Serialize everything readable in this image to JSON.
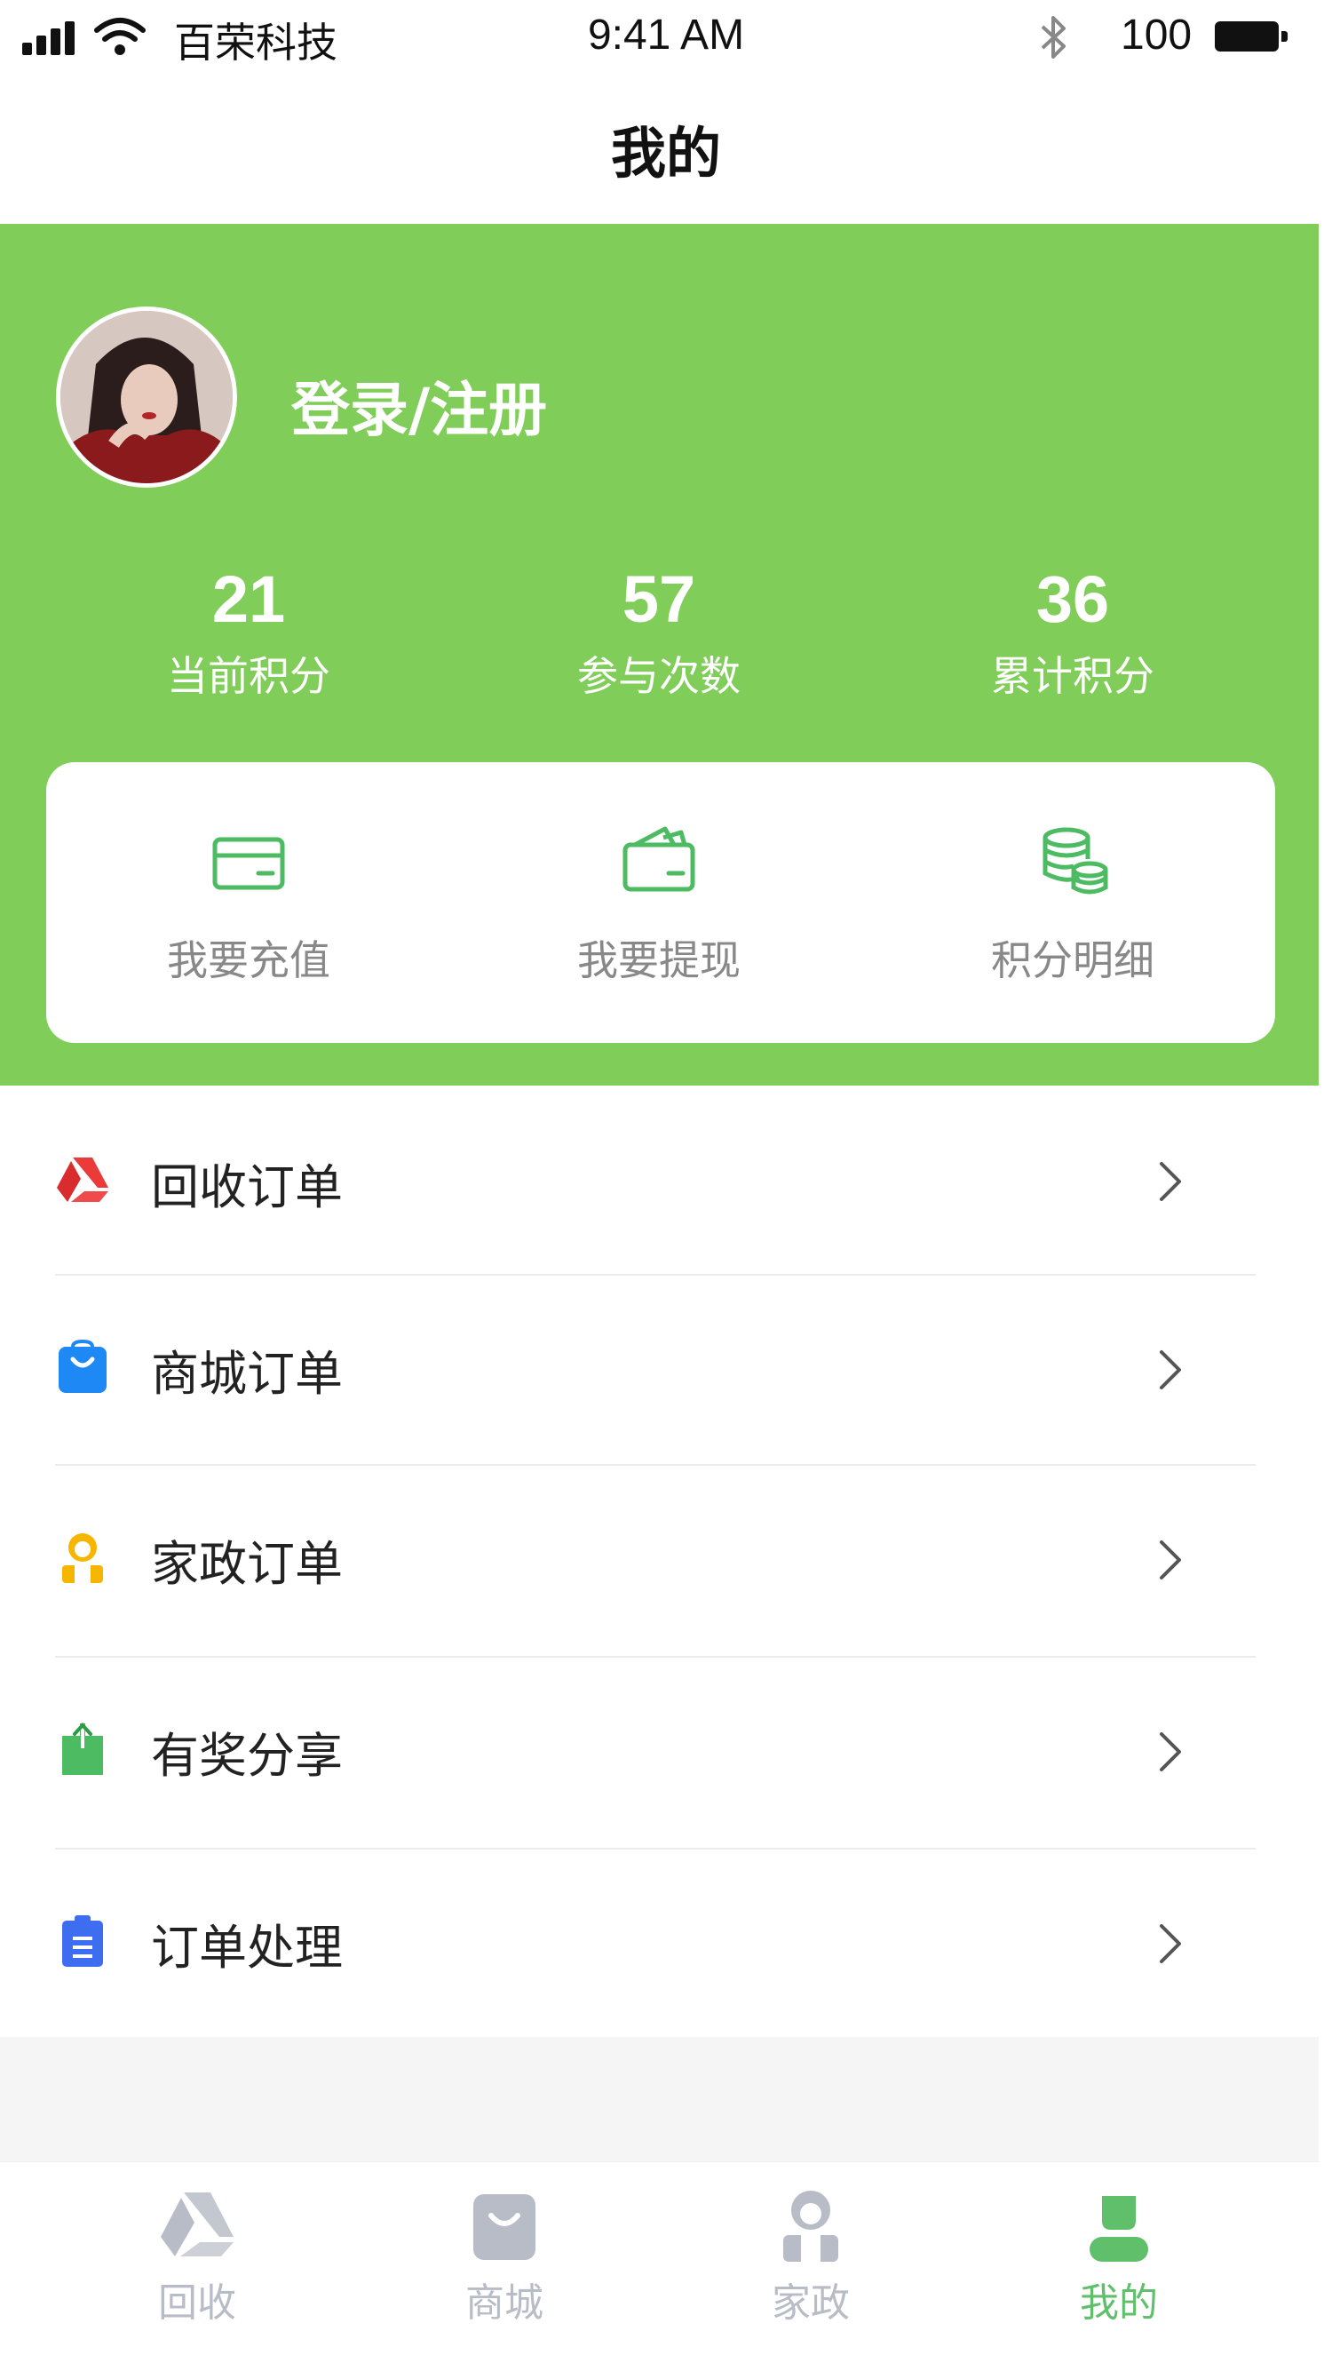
{
  "status_bar": {
    "carrier": "百荣科技",
    "time": "9:41 AM",
    "battery": "100"
  },
  "nav": {
    "title": "我的"
  },
  "profile": {
    "login_label": "登录/注册",
    "stats": [
      {
        "value": "21",
        "label": "当前积分"
      },
      {
        "value": "57",
        "label": "参与次数"
      },
      {
        "value": "36",
        "label": "累计积分"
      }
    ]
  },
  "actions": [
    {
      "label": "我要充值",
      "icon": "card-icon"
    },
    {
      "label": "我要提现",
      "icon": "wallet-icon"
    },
    {
      "label": "积分明细",
      "icon": "coins-icon"
    }
  ],
  "menu": [
    {
      "label": "回收订单",
      "icon": "recycle-icon",
      "color": "#ea3a3a"
    },
    {
      "label": "商城订单",
      "icon": "shopping-bag-icon",
      "color": "#1e88f5"
    },
    {
      "label": "家政订单",
      "icon": "housekeeper-icon",
      "color": "#f6b600"
    },
    {
      "label": "有奖分享",
      "icon": "share-icon",
      "color": "#4dbb62"
    },
    {
      "label": "订单处理",
      "icon": "clipboard-icon",
      "color": "#3f6df0"
    }
  ],
  "tabs": [
    {
      "label": "回收",
      "icon": "recycle-tab-icon",
      "active": false
    },
    {
      "label": "商城",
      "icon": "mall-tab-icon",
      "active": false
    },
    {
      "label": "家政",
      "icon": "housekeeping-tab-icon",
      "active": false
    },
    {
      "label": "我的",
      "icon": "profile-tab-icon",
      "active": true
    }
  ],
  "colors": {
    "header_green": "#80cd59",
    "icon_green": "#4dbb62",
    "tab_inactive": "#b8bcc6",
    "tab_active": "#5fbf6a"
  }
}
